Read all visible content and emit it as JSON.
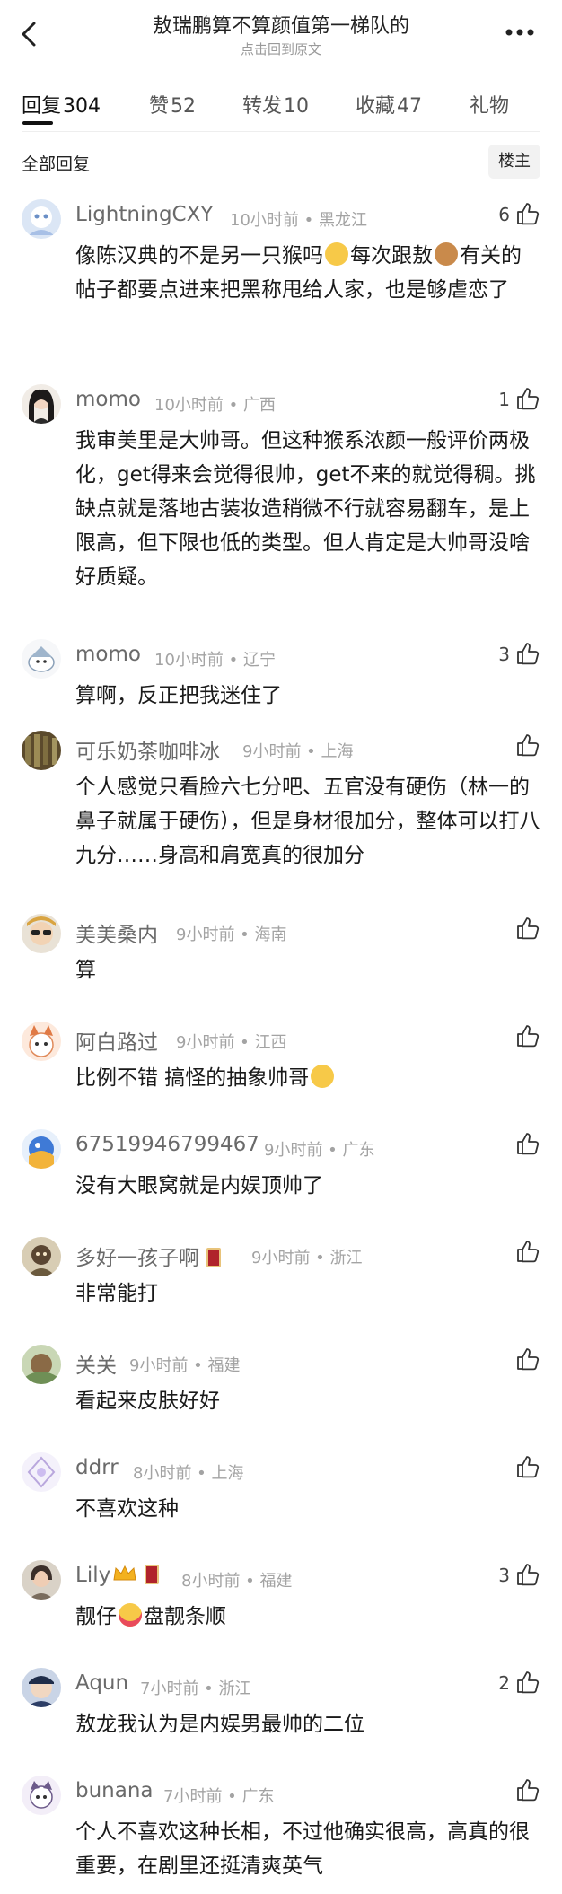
{
  "header": {
    "title": "敖瑞鹏算不算颜值第一梯队的",
    "subtitle": "点击回到原文"
  },
  "tabs": [
    {
      "label": "回复",
      "count": "304"
    },
    {
      "label": "赞",
      "count": "52"
    },
    {
      "label": "转发",
      "count": "10"
    },
    {
      "label": "收藏",
      "count": "47"
    },
    {
      "label": "礼物",
      "count": ""
    }
  ],
  "filter": {
    "label": "全部回复",
    "owner_button": "楼主"
  },
  "colors": {
    "accent_text": "#111111",
    "meta_gray": "#a3a3a3",
    "name_gray": "#6a6a6a"
  },
  "comments": [
    {
      "name": "LightningCXY",
      "time": "10小时前",
      "location": "黑龙江",
      "likes": "6",
      "text_before": "像陈汉典的不是另一只猴吗",
      "text_mid": "每次跟敖",
      "text_after": "有关的帖子都要点进来把黑称甩给人家，也是够虐恋了"
    },
    {
      "name": "momo",
      "time": "10小时前",
      "location": "广西",
      "likes": "1",
      "text": "我审美里是大帅哥。但这种猴系浓颜一般评价两极化，get得来会觉得很帅，get不来的就觉得稠。挑缺点就是落地古装妆造稍微不行就容易翻车，是上限高，但下限也低的类型。但人肯定是大帅哥没啥好质疑。"
    },
    {
      "name": "momo",
      "time": "10小时前",
      "location": "辽宁",
      "likes": "3",
      "text": "算啊，反正把我迷住了"
    },
    {
      "name": "可乐奶茶咖啡冰",
      "time": "9小时前",
      "location": "上海",
      "likes": "",
      "text": "个人感觉只看脸六七分吧、五官没有硬伤（林一的鼻子就属于硬伤），但是身材很加分，整体可以打八九分……身高和肩宽真的很加分"
    },
    {
      "name": "美美桑内",
      "time": "9小时前",
      "location": "海南",
      "likes": "",
      "text": "算"
    },
    {
      "name": "阿白路过",
      "time": "9小时前",
      "location": "江西",
      "likes": "",
      "text": "比例不错  搞怪的抽象帅哥"
    },
    {
      "name": "67519946799467",
      "time": "9小时前",
      "location": "广东",
      "likes": "",
      "text": "没有大眼窝就是内娱顶帅了"
    },
    {
      "name": "多好一孩子啊",
      "time": "9小时前",
      "location": "浙江",
      "likes": "",
      "text": "非常能打"
    },
    {
      "name": "关关",
      "time": "9小时前",
      "location": "福建",
      "likes": "",
      "text": "看起来皮肤好好"
    },
    {
      "name": "ddrr",
      "time": "8小时前",
      "location": "上海",
      "likes": "",
      "text": "不喜欢这种"
    },
    {
      "name": "Lily",
      "time": "8小时前",
      "location": "福建",
      "likes": "3",
      "text_before": "靓仔",
      "text_after": "盘靓条顺"
    },
    {
      "name": "Aqun",
      "time": "7小时前",
      "location": "浙江",
      "likes": "2",
      "text": "敖龙我认为是内娱男最帅的二位"
    },
    {
      "name": "bunana",
      "time": "7小时前",
      "location": "广东",
      "likes": "",
      "text": "个人不喜欢这种长相，不过他确实很高，高真的很重要，在剧里还挺清爽英气"
    }
  ]
}
